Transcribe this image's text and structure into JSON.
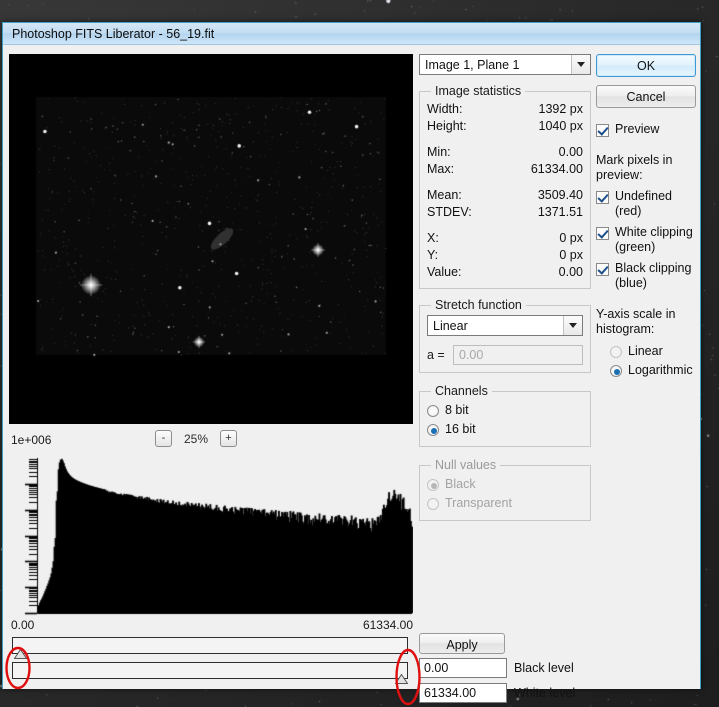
{
  "window": {
    "title": "Photoshop FITS Liberator - 56_19.fit"
  },
  "plane_selector": {
    "value": "Image 1, Plane 1",
    "arrow_icon": "chevron-down-icon"
  },
  "image_statistics": {
    "legend": "Image statistics",
    "rows": [
      {
        "label": "Width:",
        "value": "1392 px"
      },
      {
        "label": "Height:",
        "value": "1040 px"
      },
      {
        "label": "Min:",
        "value": "0.00"
      },
      {
        "label": "Max:",
        "value": "61334.00"
      },
      {
        "label": "Mean:",
        "value": "3509.40"
      },
      {
        "label": "STDEV:",
        "value": "1371.51"
      },
      {
        "label": "X:",
        "value": "0 px"
      },
      {
        "label": "Y:",
        "value": "0 px"
      },
      {
        "label": "Value:",
        "value": "0.00"
      }
    ]
  },
  "stretch_function": {
    "legend": "Stretch function",
    "value": "Linear",
    "a_label": "a =",
    "a_value": "0.00",
    "arrow_icon": "chevron-down-icon"
  },
  "channels": {
    "legend": "Channels",
    "options": [
      {
        "label": "8 bit",
        "selected": false
      },
      {
        "label": "16 bit",
        "selected": true
      }
    ]
  },
  "null_values": {
    "legend": "Null values",
    "disabled": true,
    "options": [
      {
        "label": "Black",
        "selected": true
      },
      {
        "label": "Transparent",
        "selected": false
      }
    ]
  },
  "buttons": {
    "ok": "OK",
    "cancel": "Cancel",
    "apply": "Apply"
  },
  "preview_option": {
    "label": "Preview",
    "checked": true
  },
  "mark_pixels": {
    "title": "Mark pixels in preview:",
    "options": [
      {
        "label": "Undefined (red)",
        "checked": true
      },
      {
        "label": "White clipping (green)",
        "checked": true
      },
      {
        "label": "Black clipping (blue)",
        "checked": true
      }
    ]
  },
  "yaxis_scale": {
    "title": "Y-axis scale in histogram:",
    "options": [
      {
        "label": "Linear",
        "selected": false
      },
      {
        "label": "Logarithmic",
        "selected": true
      }
    ]
  },
  "histogram_zoom": {
    "minus_label": "-",
    "plus_label": "+",
    "level": "25%"
  },
  "levels": {
    "black": {
      "value": "0.00",
      "label": "Black level"
    },
    "white": {
      "value": "61334.00",
      "label": "White level"
    }
  },
  "chart_data": {
    "type": "bar",
    "title": "",
    "xlabel": "",
    "ylabel": "1e+006",
    "yscale": "logarithmic",
    "ylim": [
      1,
      1000000
    ],
    "xlim": [
      0,
      61334
    ],
    "axis_labels": {
      "min": "0.00",
      "max": "61334.00"
    },
    "grid": false,
    "legend": false,
    "note": "Pixel intensity histogram: sharp peak near low values, long decaying tail, small spike near the high end.",
    "peak_x_fraction": 0.14,
    "tail_spike_x_fraction": 0.955,
    "values": [
      2,
      3,
      4,
      6,
      9,
      14,
      22,
      40,
      120,
      900,
      52000,
      640000,
      980000,
      720000,
      430000,
      300000,
      235000,
      196000,
      170000,
      152000,
      139000,
      128000,
      119000,
      111000,
      104000,
      98000,
      92000,
      87000,
      83000,
      79000,
      75000,
      72000,
      69000,
      66000,
      63000,
      61000,
      58500,
      56500,
      54500,
      52500,
      50800,
      49200,
      47600,
      46200,
      44800,
      43500,
      42300,
      41100,
      40000,
      38900,
      37900,
      36900,
      36000,
      35100,
      34200,
      33400,
      32600,
      31800,
      31100,
      30400,
      29700,
      29000,
      28400,
      27800,
      27200,
      26600,
      26100,
      25500,
      25000,
      24500,
      24000,
      23600,
      23100,
      22700,
      22200,
      21800,
      21400,
      21000,
      20700,
      20300,
      19900,
      19600,
      19200,
      18900,
      18600,
      18300,
      18000,
      17700,
      17400,
      17100,
      16800,
      16600,
      16300,
      16000,
      15800,
      15500,
      15300,
      15100,
      14800,
      14600,
      14400,
      14200,
      14000,
      13800,
      13600,
      13400,
      13200,
      13000,
      12800,
      12600,
      12400,
      12300,
      12100,
      11900,
      11700,
      11600,
      11400,
      11300,
      11100,
      11000,
      10800,
      10700,
      10500,
      10400,
      10200,
      10100,
      10000,
      9850,
      9720,
      9590,
      9460,
      9340,
      9210,
      9090,
      8970,
      8860,
      8740,
      8630,
      8520,
      8410,
      8310,
      8200,
      8100,
      8000,
      7900,
      7810,
      7710,
      7620,
      7530,
      7440,
      7350,
      7260,
      7180,
      7090,
      7010,
      6930,
      6850,
      6770,
      6700,
      6620,
      6550,
      6470,
      6400,
      6330,
      6260,
      6190,
      6130,
      6060,
      6000,
      5930,
      5870,
      5810,
      5750,
      5690,
      5630,
      5570,
      5510,
      5460,
      5400,
      5350,
      5290,
      5240,
      5190,
      5140,
      5090,
      5040,
      4990,
      4940,
      4900,
      4850,
      4800,
      4760,
      4720,
      4670,
      4630,
      4590,
      4550,
      4510,
      4470,
      4430
    ]
  }
}
